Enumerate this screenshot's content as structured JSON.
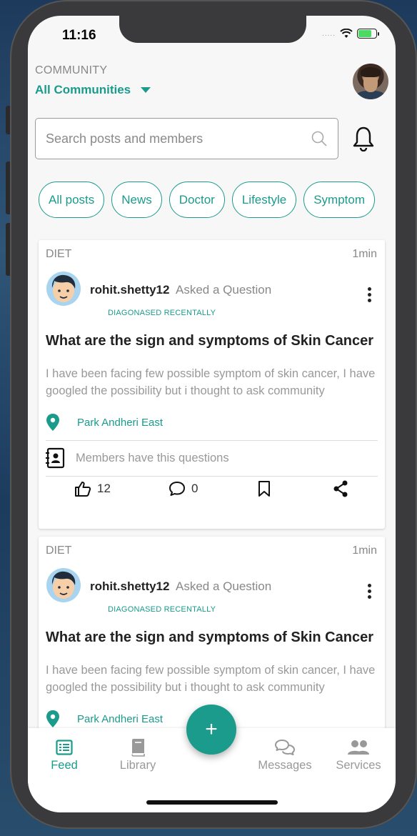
{
  "status_bar": {
    "time": "11:16",
    "signal": "....."
  },
  "header": {
    "community_label": "COMMUNITY",
    "community_value": "All Communities"
  },
  "search": {
    "placeholder": "Search posts and members"
  },
  "chips": [
    "All posts",
    "News",
    "Doctor",
    "Lifestyle",
    "Symptom"
  ],
  "posts": [
    {
      "category": "DIET",
      "time_ago": "1min",
      "username": "rohit.shetty12",
      "action": "Asked a Question",
      "tag": "DIAGONASED RECENTALLY",
      "title": "What are the sign and symptoms of Skin Cancer",
      "body": "I have been facing few possible symptom of skin cancer, I have googled the possibility but i thought to ask community",
      "location": "Park Andheri East",
      "members_text": "Members have this questions",
      "likes": "12",
      "comments": "0"
    },
    {
      "category": "DIET",
      "time_ago": "1min",
      "username": "rohit.shetty12",
      "action": "Asked a Question",
      "tag": "DIAGONASED RECENTALLY",
      "title": "What are the sign and symptoms of Skin Cancer",
      "body": "I have been facing few possible symptom of skin cancer, I have googled the possibility but i thought to ask community",
      "location": "Park Andheri East"
    }
  ],
  "fab_label": "+",
  "tabs": [
    {
      "label": "Feed",
      "icon": "feed-icon"
    },
    {
      "label": "Library",
      "icon": "book-icon"
    },
    {
      "label": "Messages",
      "icon": "chat-icon"
    },
    {
      "label": "Services",
      "icon": "people-icon"
    }
  ],
  "colors": {
    "accent": "#1a9b8b",
    "muted": "#999999"
  }
}
